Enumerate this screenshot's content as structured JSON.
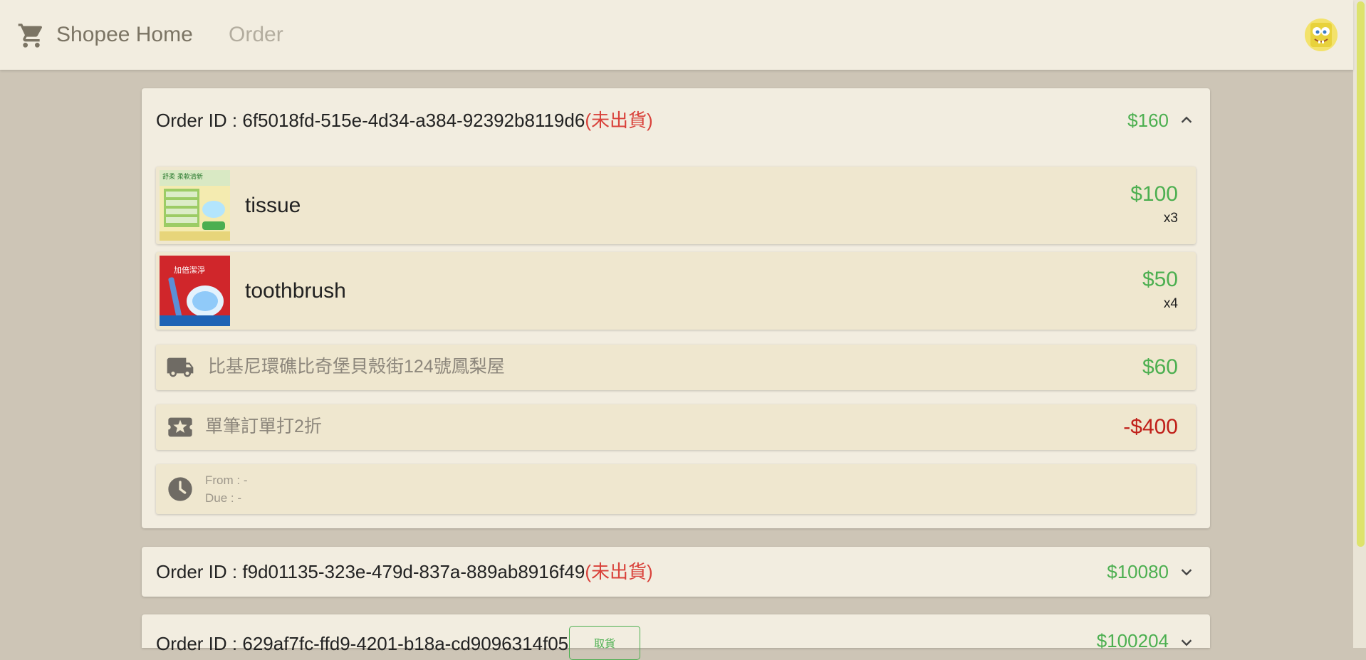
{
  "header": {
    "brand": "Shopee Home",
    "nav_order": "Order"
  },
  "orders": [
    {
      "label": "Order ID : ",
      "id": "6f5018fd-515e-4d34-a384-92392b8119d6",
      "status": "(未出貨)",
      "total": "$160",
      "expanded": true,
      "items": [
        {
          "name": "tissue",
          "price": "$100",
          "qty": "x3"
        },
        {
          "name": "toothbrush",
          "price": "$50",
          "qty": "x4"
        }
      ],
      "shipping": {
        "address": "比基尼環礁比奇堡貝殼街124號鳳梨屋",
        "fee": "$60"
      },
      "coupon": {
        "text": "單筆訂單打2折",
        "discount": "-$400"
      },
      "period": {
        "from": "From : -",
        "due": "Due : -"
      }
    },
    {
      "label": "Order ID : ",
      "id": "f9d01135-323e-479d-837a-889ab8916f49",
      "status": "(未出貨)",
      "total": "$10080",
      "expanded": false
    },
    {
      "label": "Order ID : ",
      "id": "629af7fc-ffd9-4201-b18a-cd9096314f05",
      "button": "取貨",
      "total": "$100204",
      "expanded": false
    }
  ],
  "colors": {
    "accent_green": "#4caf50",
    "status_red": "#d9413a",
    "discount_red": "#c0201a",
    "page_bg": "#cdc5b6",
    "card_bg": "#f2ede0",
    "row_bg": "#efe7cf"
  },
  "icons": [
    "cart-icon",
    "chevron-up-icon",
    "chevron-down-icon",
    "truck-icon",
    "ticket-icon",
    "clock-icon",
    "avatar"
  ]
}
